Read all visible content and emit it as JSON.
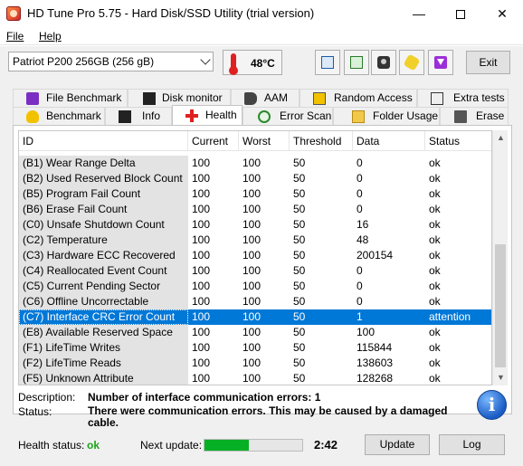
{
  "window": {
    "title": "HD Tune Pro 5.75 - Hard Disk/SSD Utility (trial version)",
    "minimize_glyph": "—",
    "close_glyph": "✕"
  },
  "menu": {
    "file": "File",
    "help": "Help"
  },
  "toolbar": {
    "drive": "Patriot P200 256GB (256 gB)",
    "temperature": "48°C",
    "exit": "Exit",
    "icons": [
      "copy-text-icon",
      "copy-screenshot-icon",
      "camera-icon",
      "options-icon",
      "save-icon"
    ]
  },
  "tabs": {
    "row1": [
      "File Benchmark",
      "Disk monitor",
      "AAM",
      "Random Access",
      "Extra tests"
    ],
    "row2": [
      "Benchmark",
      "Info",
      "Health",
      "Error Scan",
      "Folder Usage",
      "Erase"
    ],
    "active": "Health"
  },
  "table": {
    "headers": {
      "id": "ID",
      "current": "Current",
      "worst": "Worst",
      "threshold": "Threshold",
      "data": "Data",
      "status": "Status"
    },
    "rows": [
      {
        "id": "(B1) Wear Range Delta",
        "current": "100",
        "worst": "100",
        "threshold": "50",
        "data": "0",
        "status": "ok"
      },
      {
        "id": "(B2) Used Reserved Block Count",
        "current": "100",
        "worst": "100",
        "threshold": "50",
        "data": "0",
        "status": "ok"
      },
      {
        "id": "(B5) Program Fail Count",
        "current": "100",
        "worst": "100",
        "threshold": "50",
        "data": "0",
        "status": "ok"
      },
      {
        "id": "(B6) Erase Fail Count",
        "current": "100",
        "worst": "100",
        "threshold": "50",
        "data": "0",
        "status": "ok"
      },
      {
        "id": "(C0) Unsafe Shutdown Count",
        "current": "100",
        "worst": "100",
        "threshold": "50",
        "data": "16",
        "status": "ok"
      },
      {
        "id": "(C2) Temperature",
        "current": "100",
        "worst": "100",
        "threshold": "50",
        "data": "48",
        "status": "ok"
      },
      {
        "id": "(C3) Hardware ECC Recovered",
        "current": "100",
        "worst": "100",
        "threshold": "50",
        "data": "200154",
        "status": "ok"
      },
      {
        "id": "(C4) Reallocated Event Count",
        "current": "100",
        "worst": "100",
        "threshold": "50",
        "data": "0",
        "status": "ok"
      },
      {
        "id": "(C5) Current Pending Sector",
        "current": "100",
        "worst": "100",
        "threshold": "50",
        "data": "0",
        "status": "ok"
      },
      {
        "id": "(C6) Offline Uncorrectable",
        "current": "100",
        "worst": "100",
        "threshold": "50",
        "data": "0",
        "status": "ok"
      },
      {
        "id": "(C7) Interface CRC Error Count",
        "current": "100",
        "worst": "100",
        "threshold": "50",
        "data": "1",
        "status": "attention"
      },
      {
        "id": "(E8) Available Reserved Space",
        "current": "100",
        "worst": "100",
        "threshold": "50",
        "data": "100",
        "status": "ok"
      },
      {
        "id": "(F1) LifeTime Writes",
        "current": "100",
        "worst": "100",
        "threshold": "50",
        "data": "115844",
        "status": "ok"
      },
      {
        "id": "(F2) LifeTime Reads",
        "current": "100",
        "worst": "100",
        "threshold": "50",
        "data": "138603",
        "status": "ok"
      },
      {
        "id": "(F5) Unknown Attribute",
        "current": "100",
        "worst": "100",
        "threshold": "50",
        "data": "128268",
        "status": "ok"
      }
    ],
    "selected_index": 10
  },
  "details": {
    "description_label": "Description:",
    "description_value": "Number of interface communication errors: 1",
    "status_label": "Status:",
    "status_value": "There were communication errors. This may be caused by a damaged cable."
  },
  "footer": {
    "health_status_label": "Health status:",
    "health_status_value": "ok",
    "health_status_color": "#1aa31a",
    "next_update_label": "Next update:",
    "next_update_progress": 0.45,
    "countdown": "2:42",
    "update_button": "Update",
    "log_button": "Log"
  },
  "colors": {
    "selection": "#0078d7",
    "progress": "#06b025",
    "accent_red": "#e02020"
  }
}
